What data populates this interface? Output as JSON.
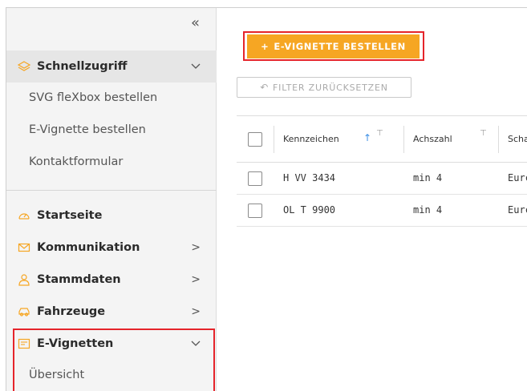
{
  "sidebar": {
    "collapse_icon": "«",
    "quick_access": {
      "label": "Schnellzugriff",
      "items": [
        "SVG fleXbox bestellen",
        "E-Vignette bestellen",
        "Kontaktformular"
      ]
    },
    "nav": [
      {
        "label": "Startseite",
        "icon": "dashboard-icon",
        "chevron": ""
      },
      {
        "label": "Kommunikation",
        "icon": "mail-icon",
        "chevron": ">"
      },
      {
        "label": "Stammdaten",
        "icon": "user-icon",
        "chevron": ">"
      },
      {
        "label": "Fahrzeuge",
        "icon": "car-icon",
        "chevron": ">"
      },
      {
        "label": "E-Vignetten",
        "icon": "vignette-icon",
        "chevron": "v"
      }
    ],
    "evignetten_sub": [
      "Übersicht"
    ],
    "accent_color": "#f6a623",
    "highlight_color": "#e5242b"
  },
  "main": {
    "order_button": {
      "plus": "+",
      "label": "E-VIGNETTE BESTELLEN"
    },
    "filter_button": {
      "icon": "↶",
      "label": "FILTER ZURÜCKSETZEN"
    },
    "table": {
      "columns": [
        "Kennzeichen",
        "Achszahl",
        "Scha"
      ],
      "sort_icon": "↑",
      "filter_icon": "⊤",
      "rows": [
        {
          "kennzeichen": "H VV 3434",
          "achszahl": "min 4",
          "third": "Eurc"
        },
        {
          "kennzeichen": "OL T 9900",
          "achszahl": "min 4",
          "third": "Eurc"
        }
      ]
    }
  }
}
